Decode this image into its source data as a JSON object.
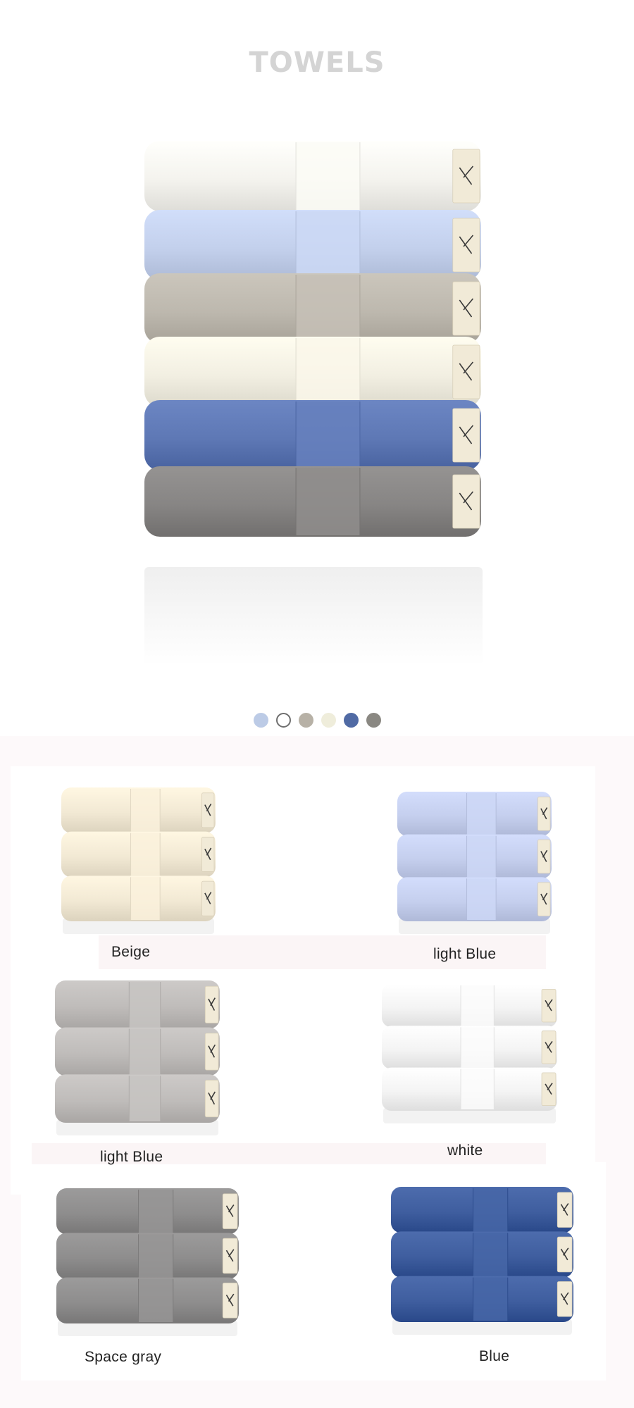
{
  "header": {
    "title": "TOWELS"
  },
  "hero": {
    "tag_icon": "brand-tag-icon",
    "towel_colors": [
      "#f4f3ee",
      "#c3d0ec",
      "#bdb8ae",
      "#f2efe2",
      "#5e78b5",
      "#878584"
    ]
  },
  "swatches": [
    {
      "name": "light-blue",
      "color": "#bccbe6"
    },
    {
      "name": "white",
      "color": "#ffffff"
    },
    {
      "name": "taupe",
      "color": "#b7b1a6"
    },
    {
      "name": "cream",
      "color": "#efeddb"
    },
    {
      "name": "navy",
      "color": "#506aa4"
    },
    {
      "name": "gray",
      "color": "#8a8882"
    }
  ],
  "variants": [
    {
      "label": "Beige",
      "color": "#f2e9d4"
    },
    {
      "label": "light Blue",
      "color": "#c5cfee"
    },
    {
      "label": "light Blue",
      "color": "#bfbcba"
    },
    {
      "label": "white",
      "color": "#f4f4f4"
    },
    {
      "label": "Space gray",
      "color": "#8e8d8d"
    },
    {
      "label": "Blue",
      "color": "#3f5e9f"
    }
  ]
}
